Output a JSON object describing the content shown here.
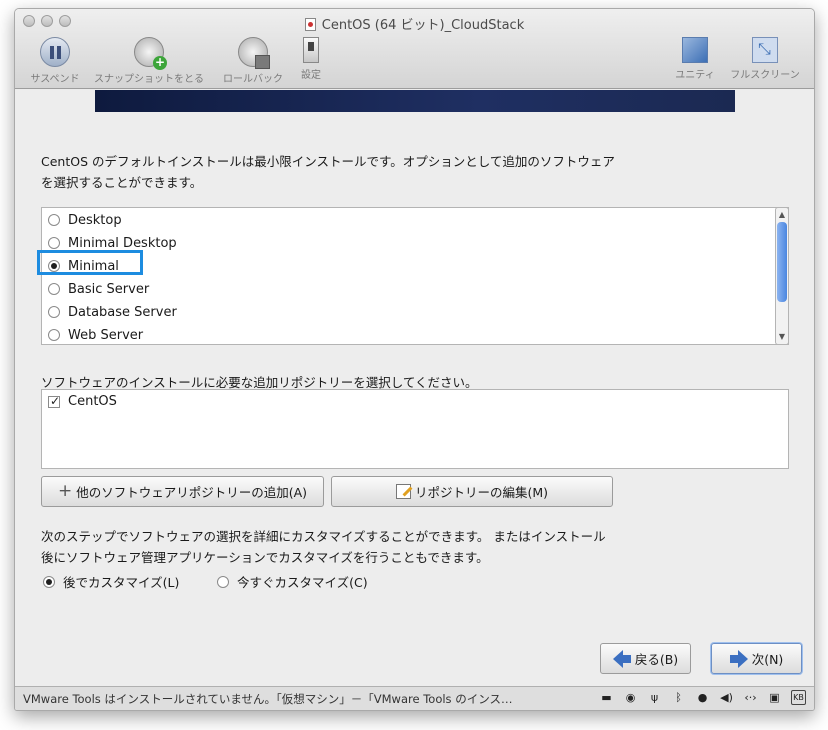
{
  "window": {
    "title": "CentOS (64 ビット)_CloudStack"
  },
  "toolbar": {
    "suspend": "サスペンド",
    "snapshot": "スナップショットをとる",
    "rollback": "ロールバック",
    "settings": "設定",
    "unity": "ユニティ",
    "fullscreen": "フルスクリーン"
  },
  "intro": {
    "line1": "CentOS のデフォルトインストールは最小限インストールです。オプションとして追加のソフトウェア",
    "line2": "を選択することができます。"
  },
  "software_options": [
    {
      "label": "Desktop",
      "selected": false
    },
    {
      "label": "Minimal Desktop",
      "selected": false
    },
    {
      "label": "Minimal",
      "selected": true
    },
    {
      "label": "Basic Server",
      "selected": false
    },
    {
      "label": "Database Server",
      "selected": false
    },
    {
      "label": "Web Server",
      "selected": false
    }
  ],
  "repo": {
    "label": "ソフトウェアのインストールに必要な追加リポジトリーを選択してください。",
    "items": [
      {
        "label": "CentOS",
        "checked": true
      }
    ],
    "add_button": "他のソフトウェアリポジトリーの追加(A)",
    "edit_button": "リポジトリーの編集(M)"
  },
  "customize": {
    "line1": "次のステップでソフトウェアの選択を詳細にカスタマイズすることができます。 またはインストール",
    "line2": "後にソフトウェア管理アプリケーションでカスタマイズを行うこともできます。",
    "later": "後でカスタマイズ(L)",
    "now": "今すぐカスタマイズ(C)",
    "selected": "later"
  },
  "nav": {
    "back": "戻る(B)",
    "next": "次(N)"
  },
  "statusbar": {
    "text": "VMware Tools はインストールされていません。「仮想マシン」－「VMware Tools のインス…"
  },
  "colors": {
    "highlight": "#1d8ce0",
    "banner": "#1b2952",
    "arrow": "#3b6fc1"
  }
}
